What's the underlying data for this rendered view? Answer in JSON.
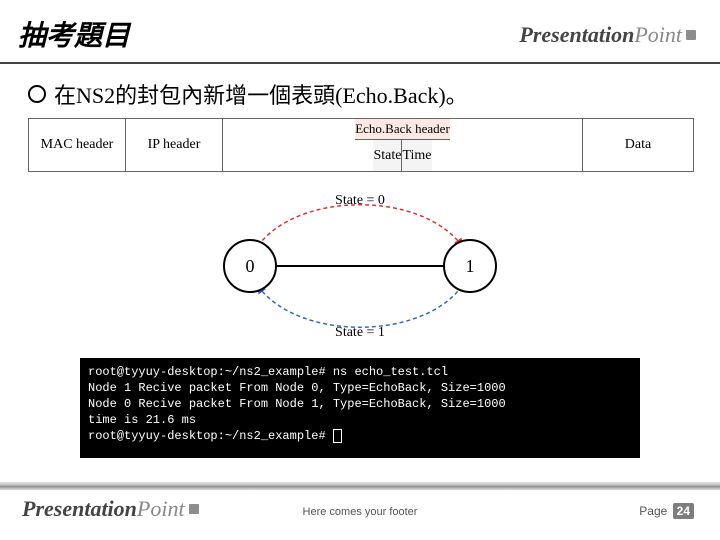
{
  "brand": {
    "part1": "Presentation",
    "part2": "Point"
  },
  "title": "抽考題目",
  "bullet": "在NS2的封包內新增一個表頭(Echo.Back)。",
  "packet": {
    "mac": "MAC header",
    "ip": "IP header",
    "echo_title": "Echo.Back header",
    "state": "State",
    "time": "Time",
    "data": "Data"
  },
  "diagram": {
    "state0_label": "State = 0",
    "state1_label": "State = 1",
    "node0": "0",
    "node1": "1"
  },
  "terminal": {
    "lines": [
      "root@tyyuy-desktop:~/ns2_example# ns echo_test.tcl",
      "Node 1 Recive packet From Node 0, Type=EchoBack, Size=1000",
      "Node 0 Recive packet From Node 1, Type=EchoBack, Size=1000",
      "time is 21.6 ms",
      "root@tyyuy-desktop:~/ns2_example# "
    ]
  },
  "footer": "Here comes your footer",
  "page_label": "Page ",
  "page_num": "24"
}
